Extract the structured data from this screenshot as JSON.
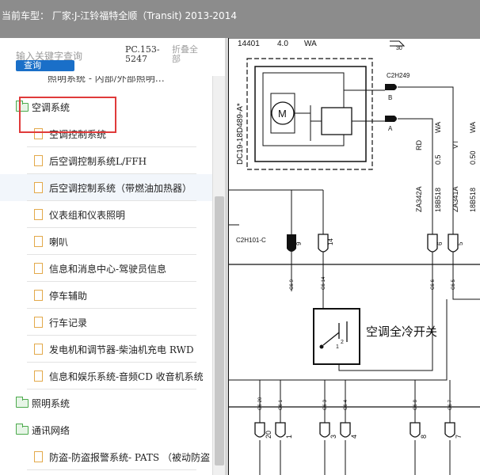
{
  "titlebar": {
    "text": "当前车型： 厂家:J-江铃福特全顺（Transit) 2013-2014"
  },
  "search": {
    "placeholder": "输入关键字查询",
    "button": "查询"
  },
  "doc_code": "PC.153-5247",
  "collapse_all": "折叠全部",
  "tree": {
    "partial_top": "照明系统 - 内部/外部照明…",
    "items": [
      {
        "type": "folder",
        "label": "空调系统"
      },
      {
        "type": "doc",
        "label": "空调控制系统"
      },
      {
        "type": "doc",
        "label": "后空调控制系统L/FFH"
      },
      {
        "type": "doc",
        "label": "后空调控制系统（带燃油加热器）"
      },
      {
        "type": "doc",
        "label": "仪表组和仪表照明"
      },
      {
        "type": "doc",
        "label": "喇叭"
      },
      {
        "type": "doc",
        "label": "信息和消息中心-驾驶员信息"
      },
      {
        "type": "doc",
        "label": "停车辅助"
      },
      {
        "type": "doc",
        "label": "行车记录"
      },
      {
        "type": "doc",
        "label": "发电机和调节器-柴油机充电 RWD"
      },
      {
        "type": "doc",
        "label": "信息和娱乐系统-音频CD 收音机系统"
      },
      {
        "type": "folder",
        "label": "照明系统"
      },
      {
        "type": "folder",
        "label": "通讯网络"
      },
      {
        "type": "doc",
        "label": "防盗-防盗报警系统- PATS （被动防盗"
      }
    ]
  },
  "diagram": {
    "top_labels": [
      "14401",
      "4.0",
      "WA",
      "30"
    ],
    "vertical_code": "DC19-18D489-A*",
    "motor_symbol": "M",
    "connector_top": "C2H249",
    "pins_top": [
      "B",
      "A"
    ],
    "wire1": {
      "color": "RD",
      "gauge": "0.5",
      "type": "WA",
      "circuit": "ZA342A",
      "harness": "18B518",
      "pin": "6"
    },
    "wire2": {
      "color": "VT",
      "gauge": "0.50",
      "type": "WA",
      "circuit": "ZA341A",
      "harness": "18B518",
      "pin": "5"
    },
    "connector_mid": "C2H101-C",
    "mid_pins": [
      "9",
      "14"
    ],
    "mid_pin_labels": [
      "C6-9",
      "C6-14",
      "C6-6",
      "C6-5"
    ],
    "switch_label": "空调全冷开关",
    "switch_pins": [
      "1",
      "2"
    ],
    "bottom_pin_labels": [
      "C6-20",
      "C6-1",
      "C6-3",
      "C6-4",
      "C6-8",
      "C6-7"
    ],
    "bottom_pins": [
      "20",
      "1",
      "3",
      "4",
      "8",
      "7"
    ]
  }
}
